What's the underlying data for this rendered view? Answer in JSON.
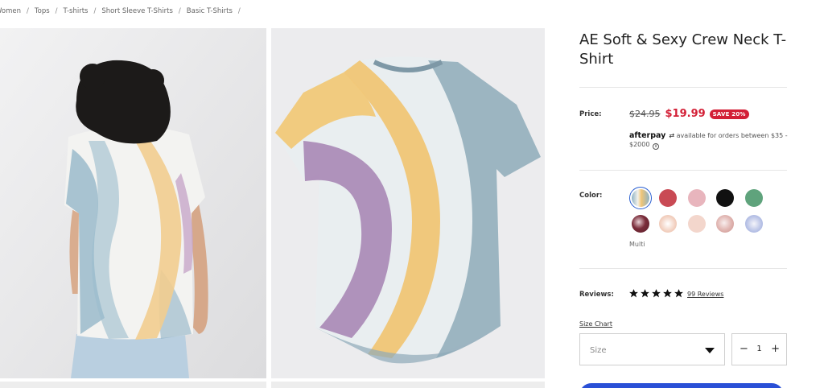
{
  "breadcrumb": [
    "Women",
    "Tops",
    "T-shirts",
    "Short Sleeve T-Shirts",
    "Basic T-Shirts"
  ],
  "breadcrumb_separator": "/",
  "product": {
    "title": "AE Soft & Sexy Crew Neck T-Shirt",
    "price_label": "Price:",
    "old_price": "$24.95",
    "new_price": "$19.99",
    "save_badge": "SAVE 20%",
    "afterpay_brand": "afterpay",
    "afterpay_text": "available for orders between $35 - $2000",
    "color_label": "Color:",
    "selected_color_name": "Multi",
    "swatches": [
      {
        "name": "multi-tie-dye",
        "color": "#e8c98a",
        "selected": true
      },
      {
        "name": "red",
        "color": "#c94a54"
      },
      {
        "name": "light-pink",
        "color": "#e8b5bd"
      },
      {
        "name": "black",
        "color": "#111111"
      },
      {
        "name": "green",
        "color": "#5fa37c"
      },
      {
        "name": "burgundy-tie-dye",
        "color": "#7a2c3a"
      },
      {
        "name": "peach-tie-dye",
        "color": "#f2d0c0"
      },
      {
        "name": "blush",
        "color": "#f3d6cc"
      },
      {
        "name": "rose-tie-dye",
        "color": "#e2b8b4"
      },
      {
        "name": "lavender-tie-dye",
        "color": "#b8c2e6"
      }
    ],
    "reviews_label": "Reviews:",
    "rating": 5,
    "reviews_link": "99 Reviews",
    "size_chart_link": "Size Chart",
    "size_placeholder": "Size",
    "quantity": "1",
    "qty_minus": "−",
    "qty_plus": "+"
  },
  "colors": {
    "sale_red": "#d31f36",
    "primary_blue": "#2a50d6"
  }
}
